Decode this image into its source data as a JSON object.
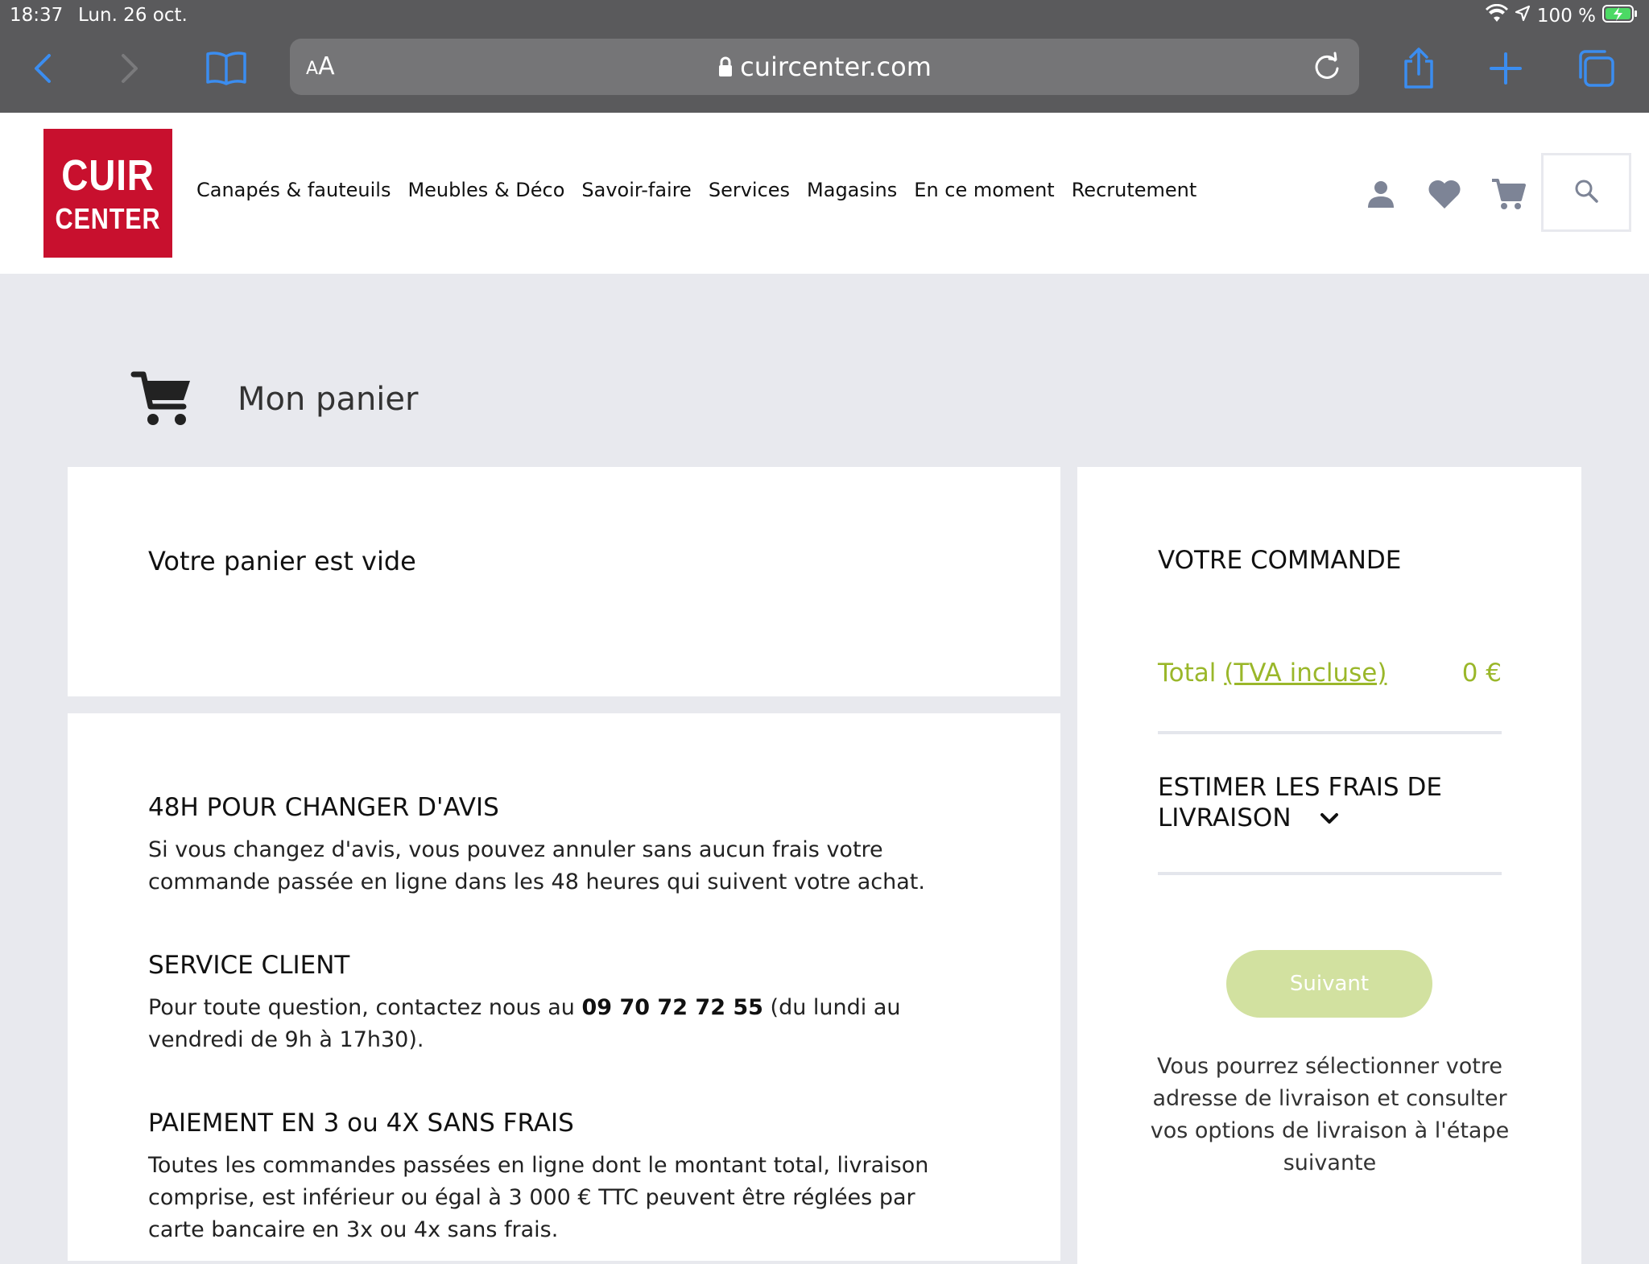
{
  "status_bar": {
    "time": "18:37",
    "date": "Lun. 26 oct.",
    "battery": "100 %"
  },
  "browser": {
    "reader_label_small": "A",
    "reader_label_large": "A",
    "url": "cuircenter.com",
    "icons": [
      "back-icon",
      "forward-icon",
      "bookmarks-icon",
      "lock-icon",
      "reload-icon",
      "share-icon",
      "new-tab-icon",
      "tabs-icon"
    ]
  },
  "header": {
    "logo_line1": "CUIR",
    "logo_line2": "CENTER",
    "nav": [
      "Canapés & fauteuils",
      "Meubles & Déco",
      "Savoir-faire",
      "Services",
      "Magasins",
      "En ce moment",
      "Recrutement"
    ],
    "icons": [
      "account-icon",
      "wishlist-heart-icon",
      "cart-icon",
      "search-icon"
    ]
  },
  "page": {
    "title": "Mon panier",
    "empty_message": "Votre panier est vide"
  },
  "info": [
    {
      "title": "48H POUR CHANGER D'AVIS",
      "body": "Si vous changez d'avis, vous pouvez annuler sans aucun frais votre commande passée en ligne dans les 48 heures qui suivent votre achat."
    },
    {
      "title": "SERVICE CLIENT",
      "body_before": "Pour toute question, contactez nous au ",
      "phone": "09 70 72 72 55",
      "body_after": " (du lundi au vendredi de 9h à 17h30)."
    },
    {
      "title": "PAIEMENT EN 3 ou 4X SANS FRAIS",
      "body": "Toutes les commandes passées en ligne dont le montant total, livraison comprise, est inférieur ou égal à 3 000 € TTC peuvent être réglées par carte bancaire en 3x ou 4x sans frais."
    }
  ],
  "order": {
    "title": "VOTRE COMMANDE",
    "total_label": "Total",
    "total_tva": "(TVA incluse)",
    "total_value": "0 €",
    "shipping_toggle": "ESTIMER LES FRAIS DE LIVRAISON",
    "next_button": "Suivant",
    "note": "Vous pourrez sélectionner votre adresse de livraison et consulter vos options de livraison à l'étape suivante"
  },
  "colors": {
    "browser_bar": "#5a5a5c",
    "browser_accent": "#3b8df0",
    "brand_red": "#c8102e",
    "total_green": "#9ab72a",
    "next_button_bg": "#d2e1a0",
    "icon_grey": "#7d8496",
    "page_bg": "#e8e9ee"
  }
}
